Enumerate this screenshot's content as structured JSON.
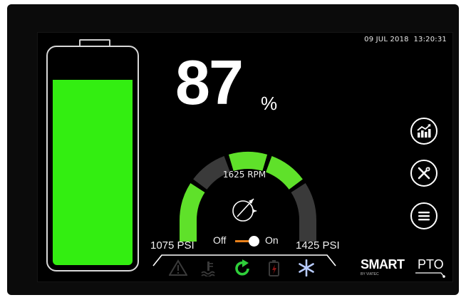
{
  "datetime": "09 JUL 2018  13:20:31",
  "battery": {
    "level_percent": 87,
    "fill_color": "#33ee11"
  },
  "charge": {
    "value": "87",
    "unit": "%"
  },
  "gauge": {
    "rpm_label": "1625 RPM",
    "min_label": "1075 PSI",
    "max_label": "1425 PSI",
    "segments_total": 5,
    "segments_active": [
      0,
      2,
      3
    ],
    "active_color": "#5fe12a",
    "inactive_color": "#3a3a3a"
  },
  "toggle": {
    "off_label": "Off",
    "on_label": "On",
    "state": "on",
    "accent_color": "#e8801a"
  },
  "side_buttons": [
    {
      "icon": "chart-icon"
    },
    {
      "icon": "tools-icon"
    },
    {
      "icon": "menu-icon"
    }
  ],
  "status_icons": [
    {
      "icon": "warning-icon",
      "active": false
    },
    {
      "icon": "coolant-temperature-icon",
      "active": false
    },
    {
      "icon": "refresh-icon",
      "active": true,
      "color": "#2fcf3a"
    },
    {
      "icon": "battery-fault-icon",
      "active": false
    },
    {
      "icon": "snowflake-icon",
      "active": true,
      "color": "#b8ccff"
    }
  ],
  "brand": {
    "smart": "SMART",
    "pto": "PTO",
    "by": "BY VIATEC"
  }
}
